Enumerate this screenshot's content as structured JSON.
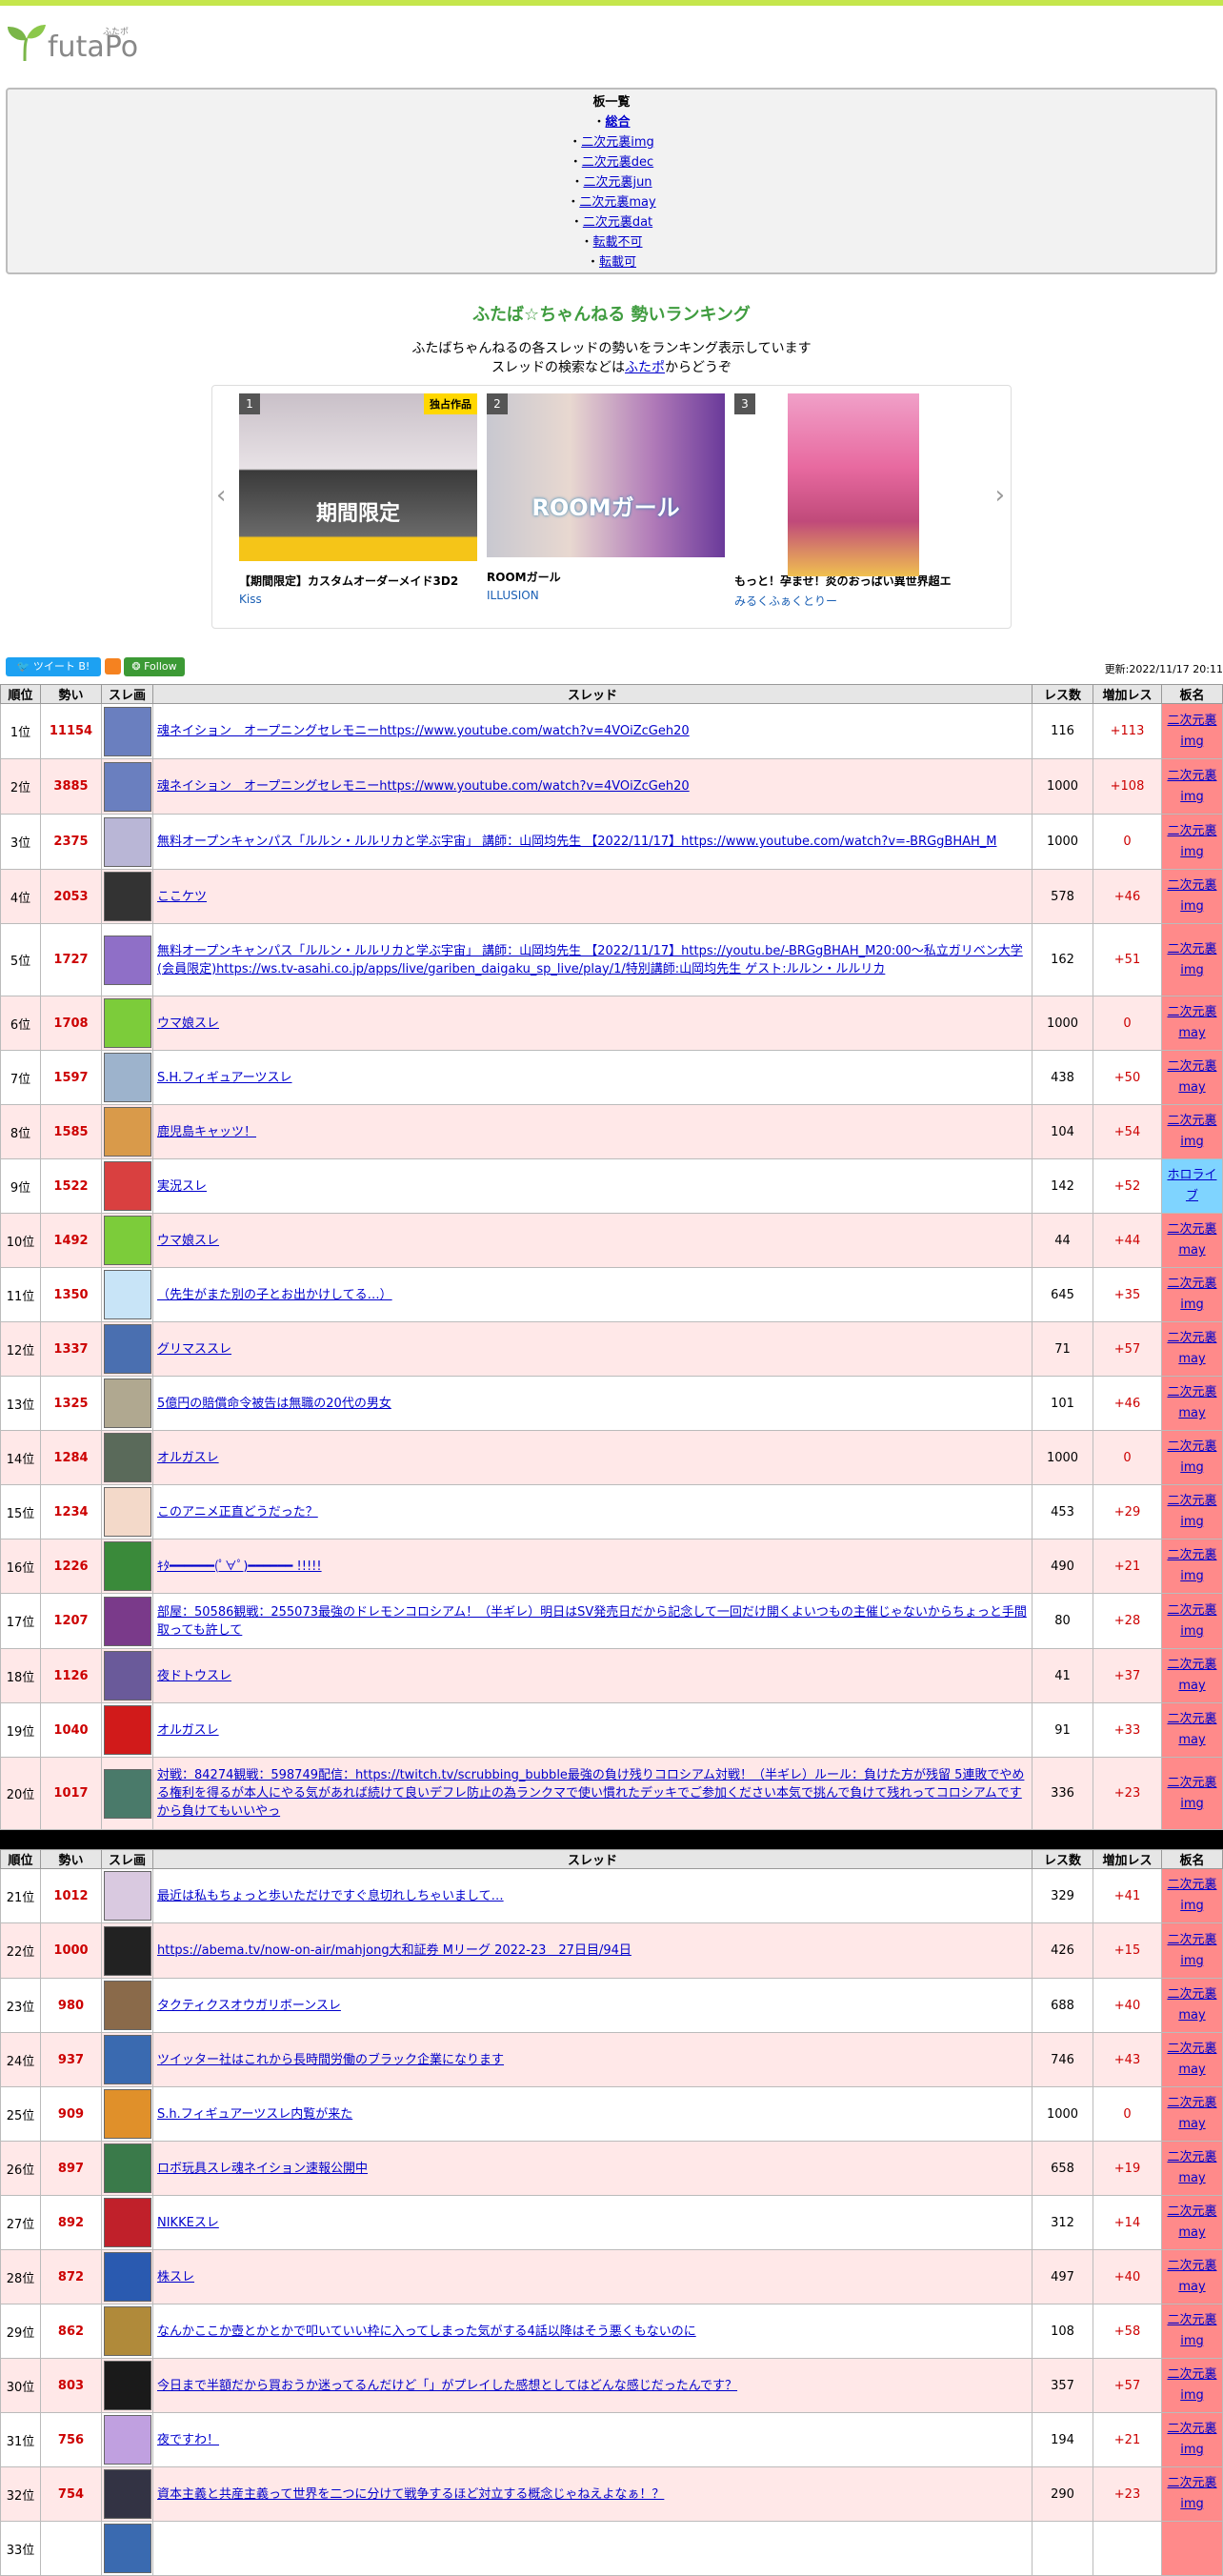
{
  "site": {
    "logo_text": "futaPo",
    "logo_ruby": "ふたポ"
  },
  "board_list": {
    "header": "板一覧",
    "items": [
      {
        "label": "総合",
        "bold": true
      },
      {
        "label": "二次元裏img"
      },
      {
        "label": "二次元裏dec"
      },
      {
        "label": "二次元裏jun"
      },
      {
        "label": "二次元裏may"
      },
      {
        "label": "二次元裏dat"
      },
      {
        "label": "転載不可"
      },
      {
        "label": "転載可"
      }
    ]
  },
  "ranking": {
    "title": "ふたば☆ちゃんねる 勢いランキング",
    "desc1": "ふたばちゃんねるの各スレッドの勢いをランキング表示しています",
    "desc2_pre": "スレッドの検索などは",
    "desc2_link": "ふたポ",
    "desc2_post": "からどうぞ"
  },
  "carousel": [
    {
      "num": "1",
      "title": "【期間限定】カスタムオーダーメイド3D2",
      "maker": "Kiss",
      "badge": "独占作品",
      "banner": "期間限定"
    },
    {
      "num": "2",
      "title": "ROOMガール",
      "maker": "ILLUSION",
      "banner": "ROOMガール"
    },
    {
      "num": "3",
      "title": "もっと！孕ませ！炎のおっぱい異世界超エ",
      "maker": "みるくふぁくとりー"
    }
  ],
  "social": {
    "tweet": "ツイート",
    "follow": "Follow"
  },
  "updated": "更新:2022/11/17 20:11",
  "table_headers": {
    "rank": "順位",
    "speed": "勢い",
    "thumb": "スレ画",
    "thread": "スレッド",
    "res": "レス数",
    "inc": "増加レス",
    "board": "板名"
  },
  "rows": [
    {
      "rank": "1位",
      "speed": "11154",
      "title": "魂ネイション　オープニングセレモニーhttps://www.youtube.com/watch?v=4VOiZcGeh20",
      "res": "116",
      "inc": "+113",
      "board": "二次元裏img",
      "color": "#6a7fbf"
    },
    {
      "rank": "2位",
      "speed": "3885",
      "title": "魂ネイション　オープニングセレモニーhttps://www.youtube.com/watch?v=4VOiZcGeh20",
      "res": "1000",
      "inc": "+108",
      "board": "二次元裏img",
      "color": "#6a7fbf"
    },
    {
      "rank": "3位",
      "speed": "2375",
      "title": "無料オープンキャンパス「ルルン・ルルリカと学ぶ宇宙」 講師：山岡均先生 【2022/11/17】https://www.youtube.com/watch?v=-BRGgBHAH_M",
      "res": "1000",
      "inc": "0",
      "board": "二次元裏img",
      "color": "#b9b6d6"
    },
    {
      "rank": "4位",
      "speed": "2053",
      "title": "ここケツ",
      "res": "578",
      "inc": "+46",
      "board": "二次元裏img",
      "color": "#333333"
    },
    {
      "rank": "5位",
      "speed": "1727",
      "title": "無料オープンキャンパス「ルルン・ルルリカと学ぶ宇宙」 講師：山岡均先生 【2022/11/17】https://youtu.be/-BRGgBHAH_M20:00～私立ガリベン大学(会員限定)https://ws.tv-asahi.co.jp/apps/live/gariben_daigaku_sp_live/play/1/特別講師:山岡均先生 ゲスト:ルルン・ルルリカ",
      "res": "162",
      "inc": "+51",
      "board": "二次元裏img",
      "color": "#8f6fc7"
    },
    {
      "rank": "6位",
      "speed": "1708",
      "title": "ウマ娘スレ",
      "res": "1000",
      "inc": "0",
      "board": "二次元裏may",
      "color": "#7ccc3a"
    },
    {
      "rank": "7位",
      "speed": "1597",
      "title": "S.H.フィギュアーツスレ",
      "res": "438",
      "inc": "+50",
      "board": "二次元裏may",
      "color": "#9db3cc"
    },
    {
      "rank": "8位",
      "speed": "1585",
      "title": "鹿児島キャッツ！",
      "res": "104",
      "inc": "+54",
      "board": "二次元裏img",
      "color": "#d99a4a"
    },
    {
      "rank": "9位",
      "speed": "1522",
      "title": "実況スレ",
      "res": "142",
      "inc": "+52",
      "board": "ホロライブ",
      "color": "#d94040",
      "blue": true
    },
    {
      "rank": "10位",
      "speed": "1492",
      "title": "ウマ娘スレ",
      "res": "44",
      "inc": "+44",
      "board": "二次元裏may",
      "color": "#7ccc3a"
    },
    {
      "rank": "11位",
      "speed": "1350",
      "title": "（先生がまた別の子とお出かけしてる…）",
      "res": "645",
      "inc": "+35",
      "board": "二次元裏img",
      "color": "#c8e4f7"
    },
    {
      "rank": "12位",
      "speed": "1337",
      "title": "グリマススレ",
      "res": "71",
      "inc": "+57",
      "board": "二次元裏may",
      "color": "#4a6fb0"
    },
    {
      "rank": "13位",
      "speed": "1325",
      "title": "5億円の賠償命令被告は無職の20代の男女",
      "res": "101",
      "inc": "+46",
      "board": "二次元裏may",
      "color": "#b0a890"
    },
    {
      "rank": "14位",
      "speed": "1284",
      "title": "オルガスレ",
      "res": "1000",
      "inc": "0",
      "board": "二次元裏img",
      "color": "#5a6a5a"
    },
    {
      "rank": "15位",
      "speed": "1234",
      "title": "このアニメ正直どうだった？",
      "res": "453",
      "inc": "+29",
      "board": "二次元裏img",
      "color": "#f3d9c9"
    },
    {
      "rank": "16位",
      "speed": "1226",
      "title": "ｷﾀ━━━━━━(ﾟ∀ﾟ)━━━━━━ !!!!!",
      "res": "490",
      "inc": "+21",
      "board": "二次元裏img",
      "color": "#3a8a3a"
    },
    {
      "rank": "17位",
      "speed": "1207",
      "title": "部屋：50586観戦：255073最強のドレモンコロシアム！（半ギレ）明日はSV発売日だから記念して一回だけ開くよいつもの主催じゃないからちょっと手間取っても許して",
      "res": "80",
      "inc": "+28",
      "board": "二次元裏img",
      "color": "#7a3a8a"
    },
    {
      "rank": "18位",
      "speed": "1126",
      "title": "夜ドトウスレ",
      "res": "41",
      "inc": "+37",
      "board": "二次元裏may",
      "color": "#6a5a9a"
    },
    {
      "rank": "19位",
      "speed": "1040",
      "title": "オルガスレ",
      "res": "91",
      "inc": "+33",
      "board": "二次元裏may",
      "color": "#d11a1a"
    },
    {
      "rank": "20位",
      "speed": "1017",
      "title": "対戦：84274観戦：598749配信：https://twitch.tv/scrubbing_bubble最強の負け残りコロシアム対戦！（半ギレ）ルール：負けた方が残留 5連敗でやめる権利を得るが本人にやる気があれば続けて良いデフレ防止の為ランクマで使い慣れたデッキでご参加ください本気で挑んで負けて残れってコロシアムですから負けてもいいやっ",
      "res": "336",
      "inc": "+23",
      "board": "二次元裏img",
      "color": "#4a7a6a"
    },
    {
      "rank": "21位",
      "speed": "1012",
      "title": "最近は私もちょっと歩いただけですぐ息切れしちゃいまして…",
      "res": "329",
      "inc": "+41",
      "board": "二次元裏img",
      "color": "#d9c9e0"
    },
    {
      "rank": "22位",
      "speed": "1000",
      "title": "https://abema.tv/now-on-air/mahjong大和証券 Mリーグ 2022-23　27日目/94日",
      "res": "426",
      "inc": "+15",
      "board": "二次元裏img",
      "color": "#222222"
    },
    {
      "rank": "23位",
      "speed": "980",
      "title": "タクティクスオウガリボーンスレ",
      "res": "688",
      "inc": "+40",
      "board": "二次元裏may",
      "color": "#8a6a4a"
    },
    {
      "rank": "24位",
      "speed": "937",
      "title": "ツイッター社はこれから長時間労働のブラック企業になります",
      "res": "746",
      "inc": "+43",
      "board": "二次元裏may",
      "color": "#3a6ab0"
    },
    {
      "rank": "25位",
      "speed": "909",
      "title": "S.h.フィギュアーツスレ内覧が来た",
      "res": "1000",
      "inc": "0",
      "board": "二次元裏may",
      "color": "#e0902a"
    },
    {
      "rank": "26位",
      "speed": "897",
      "title": "ロボ玩具スレ魂ネイション速報公開中",
      "res": "658",
      "inc": "+19",
      "board": "二次元裏may",
      "color": "#3a7a4a"
    },
    {
      "rank": "27位",
      "speed": "892",
      "title": "NIKKEスレ",
      "res": "312",
      "inc": "+14",
      "board": "二次元裏may",
      "color": "#c0202a"
    },
    {
      "rank": "28位",
      "speed": "872",
      "title": "株スレ",
      "res": "497",
      "inc": "+40",
      "board": "二次元裏may",
      "color": "#2a5ab0"
    },
    {
      "rank": "29位",
      "speed": "862",
      "title": "なんかここか壺とかとかで叩いていい枠に入ってしまった気がする4話以降はそう悪くもないのに",
      "res": "108",
      "inc": "+58",
      "board": "二次元裏img",
      "color": "#b08a3a"
    },
    {
      "rank": "30位",
      "speed": "803",
      "title": "今日まで半額だから買おうか迷ってるんだけど「」がプレイした感想としてはどんな感じだったんです？",
      "res": "357",
      "inc": "+57",
      "board": "二次元裏img",
      "color": "#1a1a1a"
    },
    {
      "rank": "31位",
      "speed": "756",
      "title": "夜ですわ！",
      "res": "194",
      "inc": "+21",
      "board": "二次元裏img",
      "color": "#c0a0e0"
    },
    {
      "rank": "32位",
      "speed": "754",
      "title": "資本主義と共産主義って世界を二つに分けて戦争するほど対立する概念じゃねえよなぁ！？",
      "res": "290",
      "inc": "+23",
      "board": "二次元裏img",
      "color": "#333344"
    },
    {
      "rank": "33位",
      "speed": "",
      "title": "",
      "res": "",
      "inc": "",
      "board": "",
      "color": "#3a6ab0"
    }
  ]
}
